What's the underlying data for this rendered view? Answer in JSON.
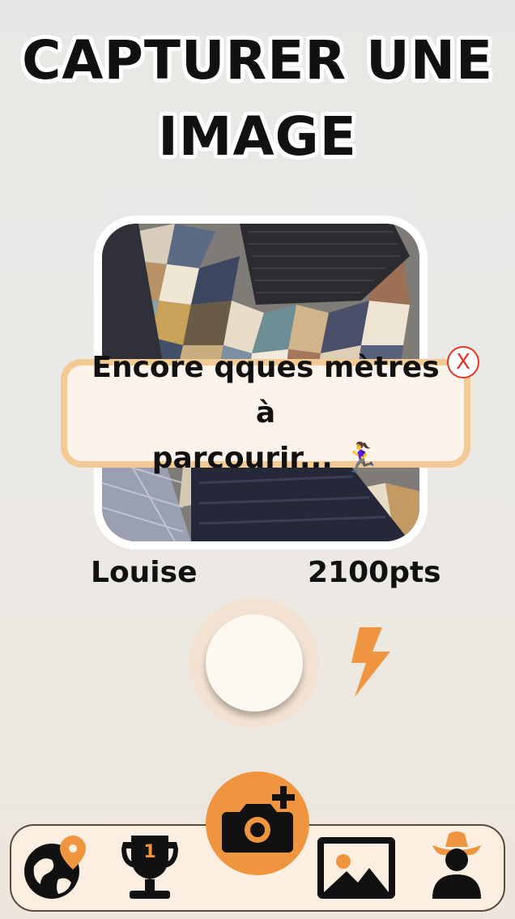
{
  "page": {
    "title": "CAPTURER UNE IMAGE"
  },
  "tooltip": {
    "line1": "Encore qques mètres à",
    "line2": "parcourir... 🏃‍♀️",
    "close_label": "X"
  },
  "player": {
    "name": "Louise",
    "points": "2100pts"
  },
  "navbar": {
    "items": [
      {
        "icon": "globe-pin-icon",
        "badge": ""
      },
      {
        "icon": "trophy-icon",
        "badge": "1"
      },
      {
        "icon": "camera-plus-icon"
      },
      {
        "icon": "gallery-image-icon"
      },
      {
        "icon": "user-cowboy-icon"
      }
    ]
  },
  "colors": {
    "accent": "#f0953f",
    "tooltip_border": "#f3c994",
    "close": "#e53424"
  }
}
